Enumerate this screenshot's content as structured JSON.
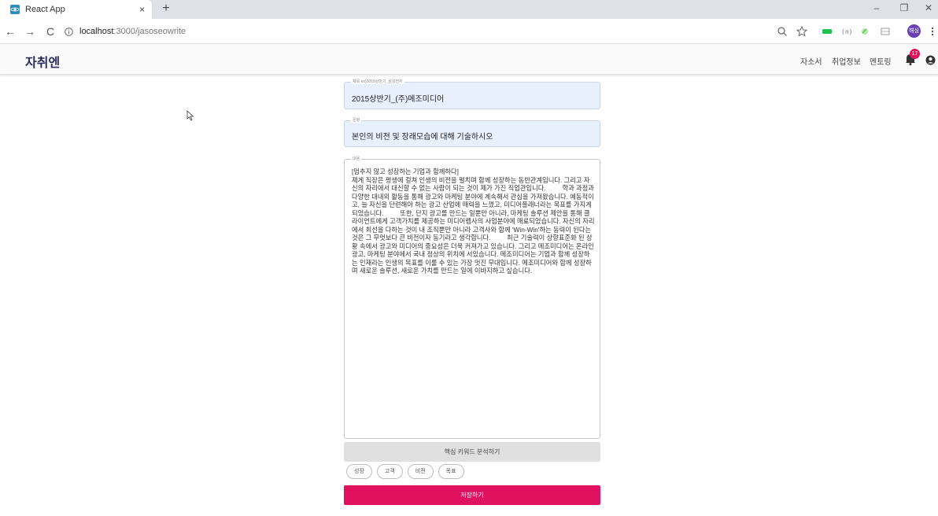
{
  "browser": {
    "tab_title": "React App",
    "tab_close": "×",
    "new_tab": "+",
    "url_host": "localhost",
    "url_path": ":3000/jasoseowrite",
    "back": "←",
    "forward": "→",
    "reload": "C",
    "minimize": "–",
    "restore": "❐",
    "close": "✕",
    "profile_initials": "해심"
  },
  "app": {
    "brand": "자취엔",
    "nav": [
      "자소서",
      "취업정보",
      "멘토링"
    ],
    "notification_count": "17"
  },
  "form": {
    "title_label": "제목 ex)2019상반기_삼성전자",
    "title_value": "2015상반기_(주)메조미디어",
    "question_label": "문항",
    "question_value": "본인의 비전 및 장래모습에 대해 기술하시오",
    "content_label": "내용",
    "content_value": "[멈추지 않고 성장하는 기업과 함께하다]\n제게 직장은 평생에 걸쳐 인생의 비전을 펼치며 함께 성장하는 동반관계입니다. 그리고 자신의 자리에서 대신할 수 없는 사람이 되는 것이 제가 가진 직업관입니다.         학과 과정과 다양한 대내외 활동을 통해 광고와 마케팅 분야에 계속해서 관심을 가져왔습니다. 예동적이고, 늘 자신을 단련해야 하는 광고 산업에 매력을 느꼈고, 미디어플래너라는 목표를 가지게 되었습니다.         또한, 단지 광고를 만드는 일뿐만 아니라, 마케팅 솔루션 제안을 통해 클라이언트에게 고객가치를 제공하는 미디어렙사의 사업분야에 매료되었습니다. 자신의 자리에서 최선을 다하는 것이 내 조직뿐만 아니라 고객사와 함께 'Win-Win'하는 동력이 된다는 것은 그 무엇보다 큰 비전이자 동기라고 생각합니다.         최근 기술력이 상향표준화 된 상황 속에서 광고와 미디어의 중요성은 더욱 커져가고 있습니다. 그리고 메조미디어는 온라인 광고, 마케팅 분야에서 국내 정상의 위치에 서있습니다. 메조미디어는 기업과 함께 성장하는 인재라는 인생의 목표를 이룰 수 있는 가장 멋진 무대입니다. 메조미디어와 함께 성장하며 새로운 솔루션, 새로운 가치를 만드는 일에 이바지하고 싶습니다.",
    "analyze_label": "핵심 키워드 분석하기",
    "keywords": [
      "성장",
      "고객",
      "비전",
      "목표"
    ],
    "save_label": "저장하기"
  },
  "colors": {
    "accent": "#e0115f",
    "field_bg": "#e8f0fe",
    "brand": "#2c2c5e"
  }
}
